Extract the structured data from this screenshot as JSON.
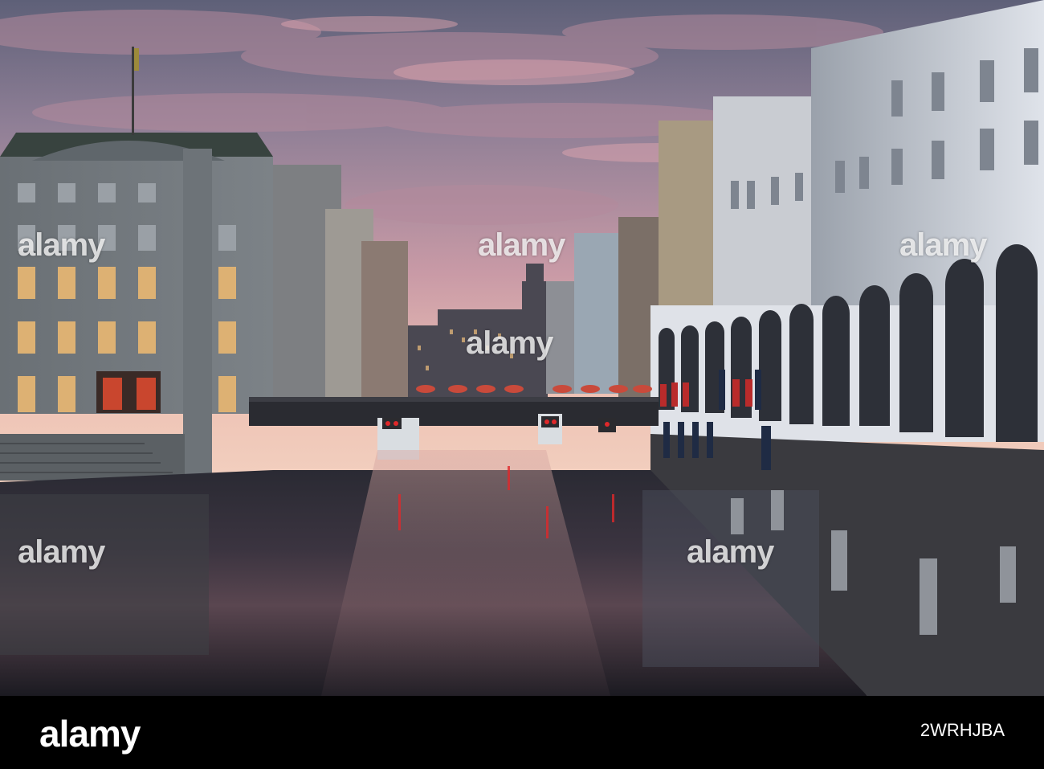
{
  "watermark": {
    "text": "alamy"
  },
  "footer": {
    "logo": "alamy",
    "image_id": "2WRHJBA"
  },
  "colors": {
    "sky_top": "#6b6c86",
    "sky_mid": "#c79aa8",
    "sky_horizon": "#f1c6b8",
    "building_left": "#6f7579",
    "arcade_white": "#e4e6ea",
    "water_dark": "#1d1c24",
    "lamp_red": "#e0282a",
    "footer_bg": "#000000"
  }
}
